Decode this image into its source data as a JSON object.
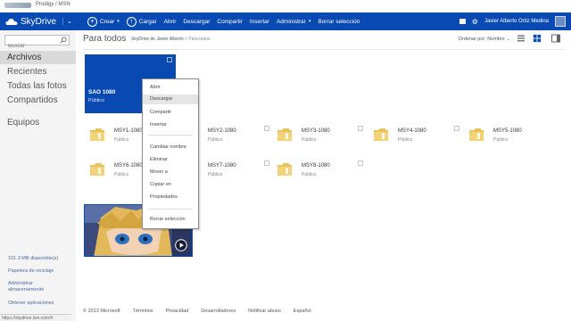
{
  "browser": {
    "tab_title": "Prodigy / MSN"
  },
  "app": {
    "brand": "SkyDrive",
    "brand_color": "#094ab2"
  },
  "toolbar": {
    "crear": "Crear",
    "cargar": "Cargar",
    "abrir": "Abrir",
    "descargar": "Descargar",
    "compartir": "Compartir",
    "insertar": "Insertar",
    "administrar": "Administrar",
    "borrar": "Borrar selección",
    "user": "Javier Alberto Ortiz Medina"
  },
  "sidebar": {
    "search_placeholder": "Buscar",
    "items": [
      {
        "label": "Archivos"
      },
      {
        "label": "Recientes"
      },
      {
        "label": "Todas las fotos"
      },
      {
        "label": "Compartidos"
      },
      {
        "label": "Equipos"
      }
    ],
    "storage": "101.3 MB disponible(s)",
    "recycle": "Papelera de reciclaje",
    "manage_storage_1": "Administrar",
    "manage_storage_2": "almacenamiento",
    "get_apps": "Obtener aplicaciones",
    "status_url": "https://skydrive.live.com/#"
  },
  "main": {
    "title": "Para todos",
    "breadcrumb_1": "SkyDrive de Javier Alberto",
    "breadcrumb_sep": ">",
    "breadcrumb_2": "Para todos",
    "sort": "Ordenar por: Nombre",
    "tiles": {
      "sao": {
        "name": "SAO 1080",
        "sub": "Público"
      }
    },
    "folders": [
      {
        "name": "MSY1-1080",
        "sub": "Público"
      },
      {
        "name": "MSY2-1080",
        "sub": "Público"
      },
      {
        "name": "MSY3-1080",
        "sub": "Público"
      },
      {
        "name": "MSY4-1080",
        "sub": "Público"
      },
      {
        "name": "MSY5-1080",
        "sub": "Público"
      },
      {
        "name": "MSY6-1080",
        "sub": "Público"
      },
      {
        "name": "MSY7-1080",
        "sub": "Público"
      },
      {
        "name": "MSY8-1080",
        "sub": "Público"
      }
    ],
    "footer": [
      "© 2013 Microsoft",
      "Términos",
      "Privacidad",
      "Desarrolladores",
      "Notificar abuso",
      "Español"
    ]
  },
  "context_menu": {
    "items": [
      "Abrir",
      "Descargar",
      "Compartir",
      "Insertar",
      "Cambiar nombre",
      "Eliminar",
      "Mover a",
      "Copiar en",
      "Propiedades",
      "Borrar selección"
    ],
    "highlighted": "Descargar"
  }
}
